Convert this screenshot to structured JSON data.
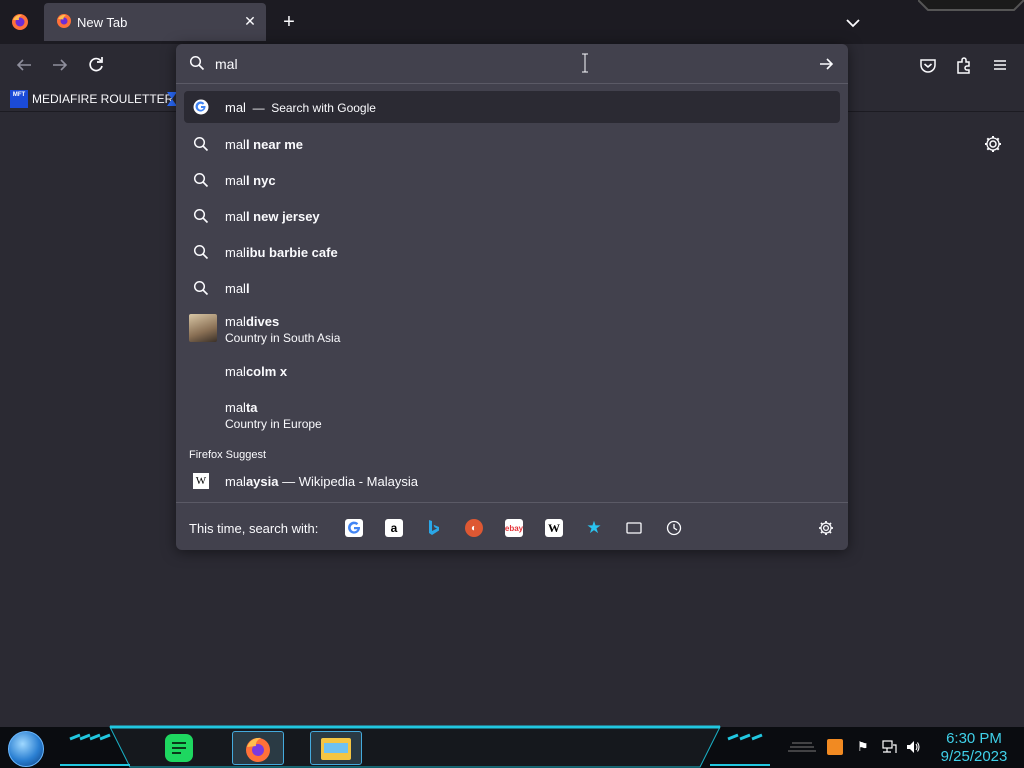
{
  "browser": {
    "tab": {
      "title": "New Tab"
    },
    "bookmarks": [
      {
        "label": "MEDIAFIRE ROULETTER",
        "icon_text": "MFT"
      }
    ]
  },
  "urlbar": {
    "value": "mal",
    "heuristic": {
      "typed": "mal",
      "separator": "—",
      "action": "Search with Google"
    },
    "suggestions": [
      {
        "typed": "mal",
        "completion": "l near me"
      },
      {
        "typed": "mal",
        "completion": "l nyc"
      },
      {
        "typed": "mal",
        "completion": "l new jersey"
      },
      {
        "typed": "mal",
        "completion": "ibu barbie cafe"
      },
      {
        "typed": "mal",
        "completion": "l"
      }
    ],
    "rich": [
      {
        "typed": "mal",
        "completion": "dives",
        "description": "Country in South Asia"
      },
      {
        "typed": "mal",
        "completion": "colm x",
        "description": ""
      },
      {
        "typed": "mal",
        "completion": "ta",
        "description": "Country in Europe"
      }
    ],
    "firefox_suggest": {
      "label": "Firefox Suggest",
      "item": {
        "typed": "mal",
        "completion": "aysia",
        "rest": "— Wikipedia - Malaysia"
      }
    },
    "oneoff": {
      "label": "This time, search with:",
      "engines": [
        "google",
        "amazon",
        "bing",
        "duckduckgo",
        "ebay",
        "wikipedia",
        "bookmarks",
        "tabs",
        "history"
      ]
    }
  },
  "taskbar": {
    "time": "6:30 PM",
    "date": "9/25/2023"
  },
  "colors": {
    "toolbar": "#2b2a33",
    "tabstrip": "#1c1b22",
    "popup": "#42414d",
    "accent": "#3fd0e8"
  }
}
